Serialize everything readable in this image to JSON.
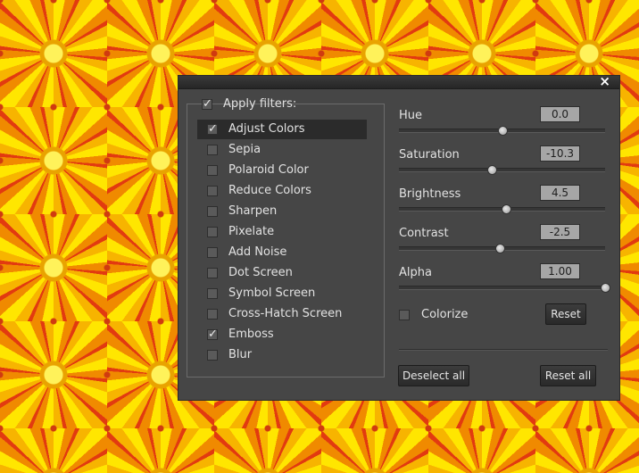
{
  "dialog": {
    "close_glyph": "×",
    "apply_filters": {
      "label": "Apply filters:",
      "checked": true
    },
    "filters": [
      {
        "label": "Adjust Colors",
        "checked": true,
        "selected": true
      },
      {
        "label": "Sepia",
        "checked": false
      },
      {
        "label": "Polaroid Color",
        "checked": false
      },
      {
        "label": "Reduce Colors",
        "checked": false
      },
      {
        "label": "Sharpen",
        "checked": false
      },
      {
        "label": "Pixelate",
        "checked": false
      },
      {
        "label": "Add Noise",
        "checked": false
      },
      {
        "label": "Dot Screen",
        "checked": false
      },
      {
        "label": "Symbol Screen",
        "checked": false
      },
      {
        "label": "Cross-Hatch Screen",
        "checked": false
      },
      {
        "label": "Emboss",
        "checked": true
      },
      {
        "label": "Blur",
        "checked": false
      }
    ],
    "sliders": [
      {
        "label": "Hue",
        "value": "0.0",
        "fraction": 0.5
      },
      {
        "label": "Saturation",
        "value": "-10.3",
        "fraction": 0.45
      },
      {
        "label": "Brightness",
        "value": "4.5",
        "fraction": 0.52
      },
      {
        "label": "Contrast",
        "value": "-2.5",
        "fraction": 0.49
      },
      {
        "label": "Alpha",
        "value": "1.00",
        "fraction": 1.0
      }
    ],
    "colorize": {
      "label": "Colorize",
      "checked": false
    },
    "reset_label": "Reset",
    "deselect_all_label": "Deselect all",
    "reset_all_label": "Reset all"
  }
}
